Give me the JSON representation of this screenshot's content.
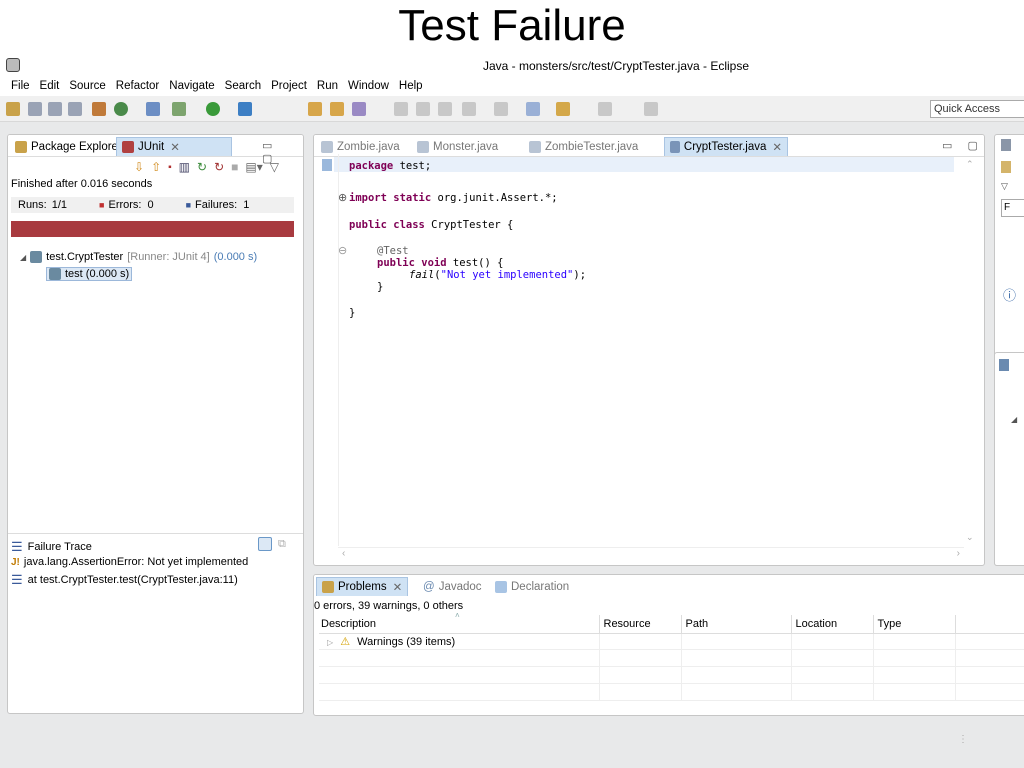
{
  "slide_title": "Test Failure",
  "window": {
    "title": "Java - monsters/src/test/CryptTester.java - Eclipse"
  },
  "menu": [
    "File",
    "Edit",
    "Source",
    "Refactor",
    "Navigate",
    "Search",
    "Project",
    "Run",
    "Window",
    "Help"
  ],
  "quick_access": "Quick Access",
  "left_panel": {
    "tabs": [
      {
        "label": "Package Explorer"
      },
      {
        "label": "JUnit"
      }
    ],
    "finished": "Finished after 0.016 seconds",
    "runs_label": "Runs:",
    "runs_value": "1/1",
    "errors_label": "Errors:",
    "errors_value": "0",
    "failures_label": "Failures:",
    "failures_value": "1",
    "progress": {
      "fraction": 1.0,
      "color": "#a83a3f"
    },
    "tree": {
      "suite": "test.CryptTester",
      "suite_runner": "[Runner: JUnit 4]",
      "suite_time": "(0.000 s)",
      "test": "test (0.000 s)"
    },
    "failure_trace": {
      "label": "Failure Trace",
      "lines": [
        "java.lang.AssertionError: Not yet implemented",
        "at test.CryptTester.test(CryptTester.java:11)"
      ]
    }
  },
  "editor": {
    "tabs": [
      {
        "label": "Zombie.java"
      },
      {
        "label": "Monster.java"
      },
      {
        "label": "ZombieTester.java"
      },
      {
        "label": "CryptTester.java"
      }
    ],
    "code": {
      "package_kw": "package",
      "package_rest": " test;",
      "import_kw": "import static",
      "import_rest": " org.junit.Assert.*;",
      "class_kw": "public class",
      "class_rest": " CryptTester {",
      "annotation": "@Test",
      "method_kw": "public void",
      "method_rest": " test() {",
      "fail_call": "fail",
      "fail_open": "(",
      "fail_str": "\"Not yet implemented\"",
      "fail_close": ");",
      "close_brace": "}",
      "class_close": "}"
    }
  },
  "problems": {
    "tabs": [
      {
        "label": "Problems"
      },
      {
        "label": "Javadoc"
      },
      {
        "label": "Declaration"
      }
    ],
    "summary": "0 errors, 39 warnings, 0 others",
    "columns": [
      "Description",
      "Resource",
      "Path",
      "Location",
      "Type"
    ],
    "rows": [
      {
        "description": "Warnings (39 items)"
      }
    ]
  }
}
